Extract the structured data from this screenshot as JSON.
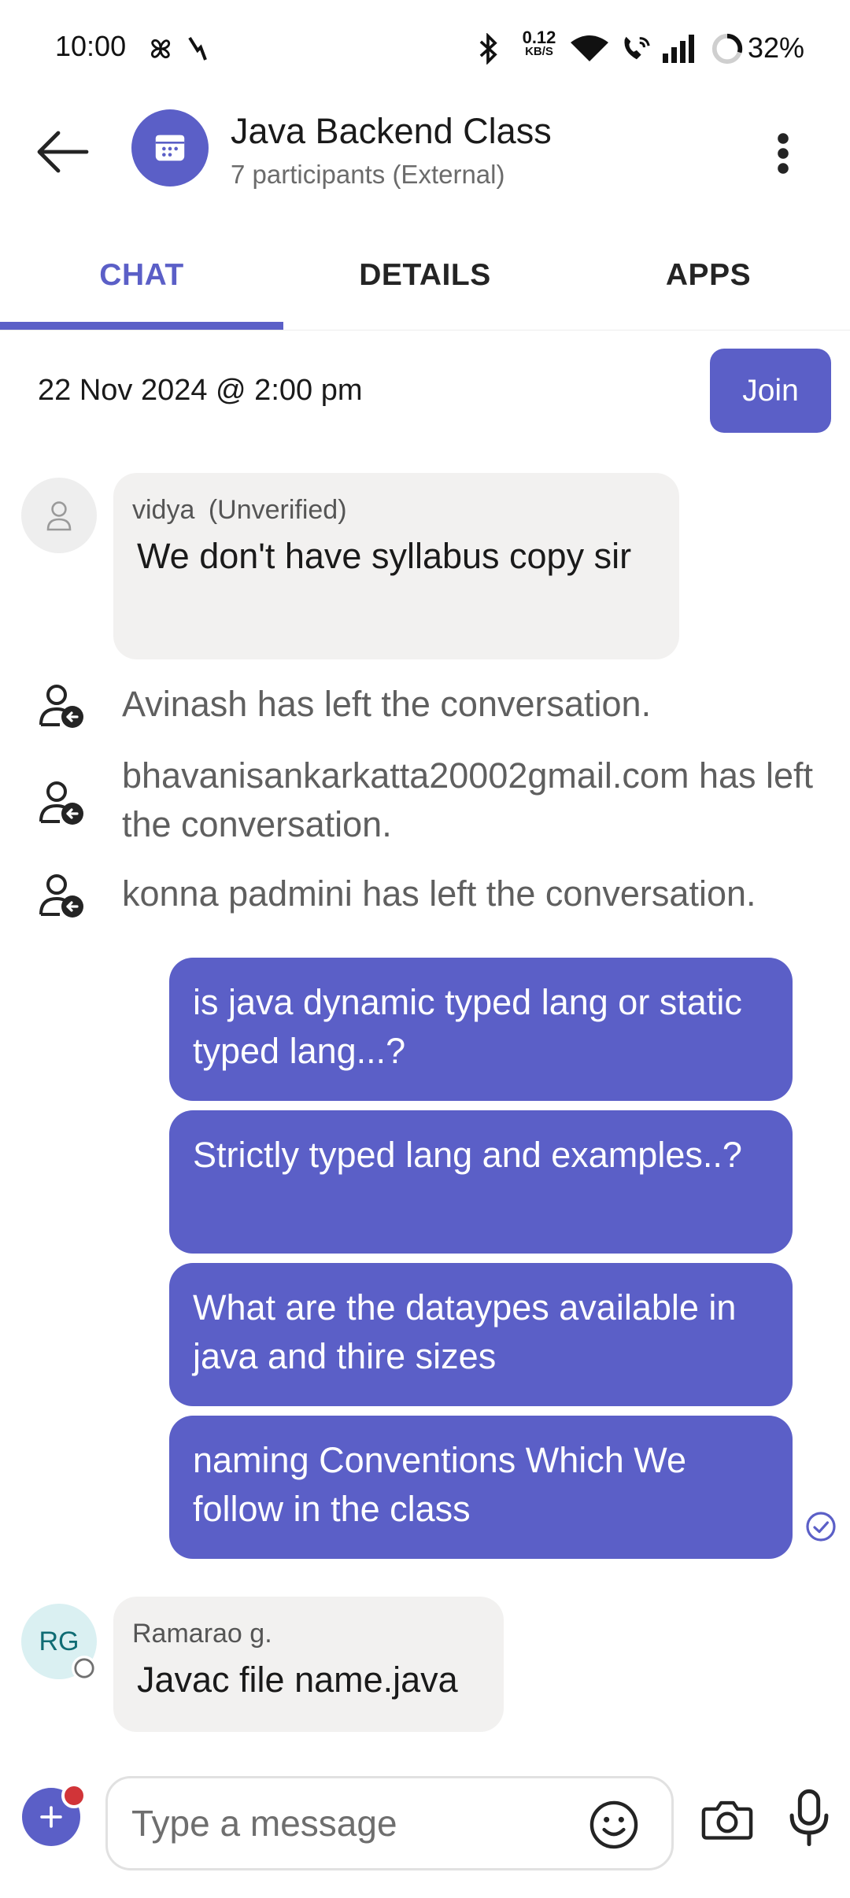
{
  "status_bar": {
    "time": "10:00",
    "net_speed_value": "0.12",
    "net_speed_unit": "KB/S",
    "battery": "32%",
    "icons": [
      "pinwheel-icon",
      "signal-slash-icon",
      "bluetooth-icon",
      "wifi-icon",
      "wifi-call-icon",
      "cell-signal-icon",
      "battery-ring-icon"
    ]
  },
  "header": {
    "title": "Java Backend Class",
    "subtitle": "7 participants (External)",
    "avatar_icon": "calendar-icon"
  },
  "tabs": [
    {
      "label": "CHAT",
      "active": true
    },
    {
      "label": "DETAILS",
      "active": false
    },
    {
      "label": "APPS",
      "active": false
    }
  ],
  "meeting": {
    "datetime": "22 Nov 2024 @ 2:00 pm",
    "join_label": "Join"
  },
  "messages": {
    "vidya": {
      "sender": "vidya",
      "tag": "(Unverified)",
      "text": "We don't have syllabus copy sir"
    },
    "system": [
      "Avinash has left the conversation.",
      "bhavanisankarkatta20002gmail.com has left the conversation.",
      "konna padmini has left the conversation."
    ],
    "outgoing": [
      "is java dynamic typed lang or static typed lang...?",
      "Strictly typed lang and examples..?",
      "What are the dataypes available in java and thire sizes",
      "naming Conventions Which We follow in the class"
    ],
    "ramarao": {
      "initials": "RG",
      "sender": "Ramarao g.",
      "text": "Javac file name.java"
    }
  },
  "composer": {
    "placeholder": "Type a message"
  },
  "colors": {
    "accent": "#5b5fc7",
    "incoming_bubble": "#f2f1f0",
    "notification_dot": "#d13438"
  }
}
